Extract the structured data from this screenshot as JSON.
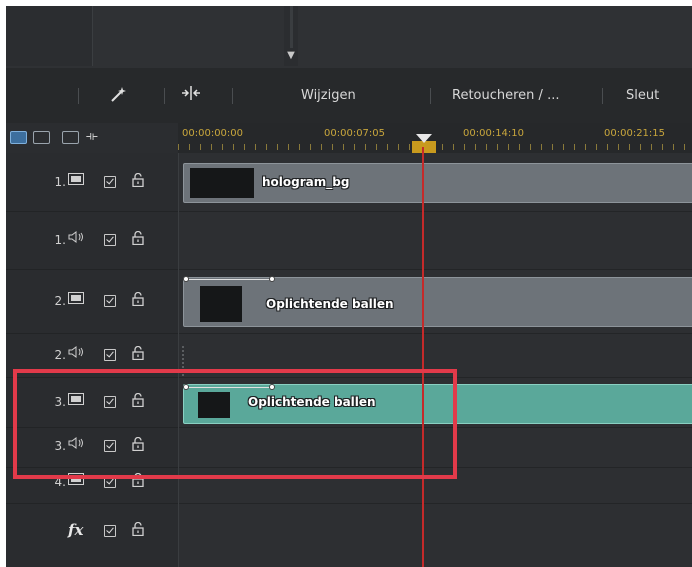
{
  "toolbar": {
    "magic_icon": "magic-wand-icon",
    "split_icon": "split-icon",
    "edit_label": "Wijzigen",
    "retouch_label": "Retoucheren / ...",
    "keys_label": "Sleut"
  },
  "ruler": {
    "timecodes": [
      "00:00:00:00",
      "00:00:07:05",
      "00:00:14:10",
      "00:00:21:15"
    ]
  },
  "tracks": [
    {
      "label": "1.",
      "type": "video",
      "clip": "hologram_bg"
    },
    {
      "label": "1.",
      "type": "audio"
    },
    {
      "label": "2.",
      "type": "video",
      "clip": "Oplichtende ballen"
    },
    {
      "label": "2.",
      "type": "audio"
    },
    {
      "label": "3.",
      "type": "video",
      "clip": "Oplichtende ballen"
    },
    {
      "label": "3.",
      "type": "audio"
    },
    {
      "label": "4.",
      "type": "video"
    },
    {
      "label": "fx",
      "type": "effects"
    }
  ],
  "colors": {
    "accent_teal": "#5aa89a",
    "playhead": "#c42a2a",
    "highlight": "#e23a4a",
    "timecode": "#c8a63c"
  }
}
